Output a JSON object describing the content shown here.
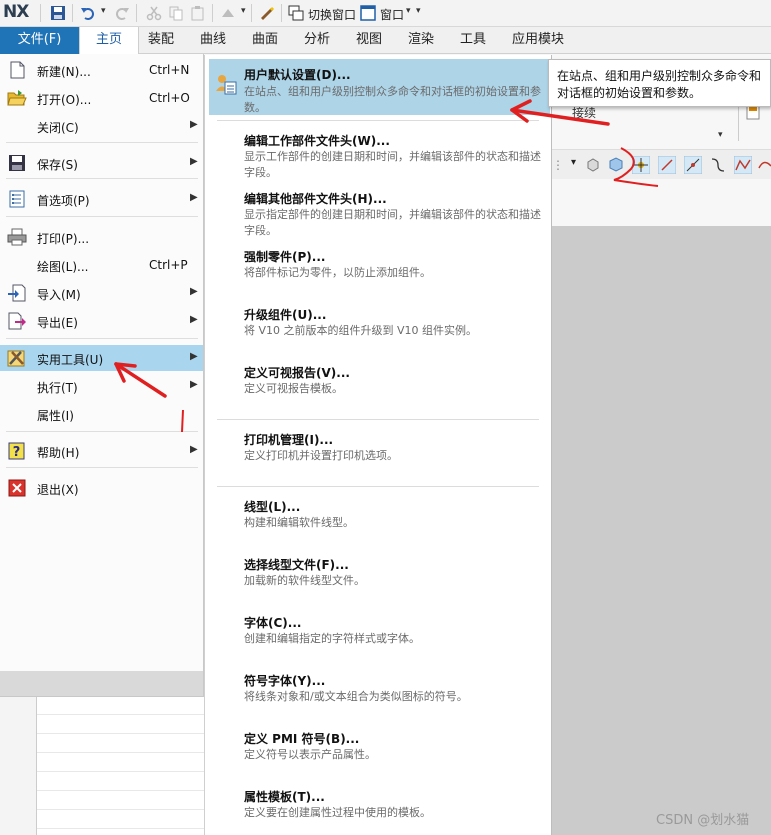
{
  "app": {
    "logo": "NX"
  },
  "quick_access": {
    "switch_window_label": "切换窗口",
    "window_label": "窗口"
  },
  "tabs": [
    "主页",
    "装配",
    "曲线",
    "曲面",
    "分析",
    "视图",
    "渲染",
    "工具",
    "应用模块"
  ],
  "file_tab": "文件(F)",
  "file_menu": {
    "items": [
      {
        "label": "新建(N)...",
        "shortcut": "Ctrl+N",
        "icon": "new-file-icon"
      },
      {
        "label": "打开(O)...",
        "shortcut": "Ctrl+O",
        "icon": "open-folder-icon"
      },
      {
        "label": "关闭(C)",
        "icon": "none"
      },
      {
        "label": "保存(S)",
        "icon": "save-icon"
      },
      {
        "label": "首选项(P)",
        "icon": "preferences-icon"
      },
      {
        "label": "打印(P)...",
        "icon": "printer-icon"
      },
      {
        "label": "绘图(L)...",
        "shortcut": "Ctrl+P",
        "icon": "none"
      },
      {
        "label": "导入(M)",
        "icon": "import-icon"
      },
      {
        "label": "导出(E)",
        "icon": "export-icon"
      },
      {
        "label": "实用工具(U)",
        "icon": "utilities-icon"
      },
      {
        "label": "执行(T)",
        "icon": "none"
      },
      {
        "label": "属性(I)",
        "icon": "none"
      },
      {
        "label": "帮助(H)",
        "icon": "help-icon"
      },
      {
        "label": "退出(X)",
        "icon": "exit-icon"
      }
    ]
  },
  "submenu": {
    "items": [
      {
        "title": "用户默认设置(D)...",
        "desc": "在站点、组和用户级别控制众多命令和对话框的初始设置和参数。"
      },
      {
        "title": "编辑工作部件文件头(W)...",
        "desc": "显示工作部件的创建日期和时间，并编辑该部件的状态和描述字段。"
      },
      {
        "title": "编辑其他部件文件头(H)...",
        "desc": "显示指定部件的创建日期和时间，并编辑该部件的状态和描述字段。"
      },
      {
        "title": "强制零件(P)...",
        "desc": "将部件标记为零件，以防止添加组件。"
      },
      {
        "title": "升级组件(U)...",
        "desc": "将 V10 之前版本的组件升级到 V10 组件实例。"
      },
      {
        "title": "定义可视报告(V)...",
        "desc": "定义可视报告模板。"
      },
      {
        "title": "打印机管理(I)...",
        "desc": "定义打印机并设置打印机选项。"
      },
      {
        "title": "线型(L)...",
        "desc": "构建和编辑软件线型。"
      },
      {
        "title": "选择线型文件(F)...",
        "desc": "加载新的软件线型文件。"
      },
      {
        "title": "字体(C)...",
        "desc": "创建和编辑指定的字符样式或字体。"
      },
      {
        "title": "符号字体(Y)...",
        "desc": "将线条对象和/或文本组合为类似图标的符号。"
      },
      {
        "title": "定义 PMI 符号(B)...",
        "desc": "定义符号以表示产品属性。"
      },
      {
        "title": "属性模板(T)...",
        "desc": "定义要在创建属性过程中使用的模板。"
      }
    ]
  },
  "tooltip": {
    "text": "在站点、组和用户级别控制众多命令和对话框的初始设置和参数。"
  },
  "ribbon_fragment": {
    "text": "接续"
  },
  "watermark": "CSDN @划水猫",
  "colors": {
    "file_tab": "#1f73b7",
    "highlight": "#a9d5ee",
    "annotation": "#e02020"
  }
}
